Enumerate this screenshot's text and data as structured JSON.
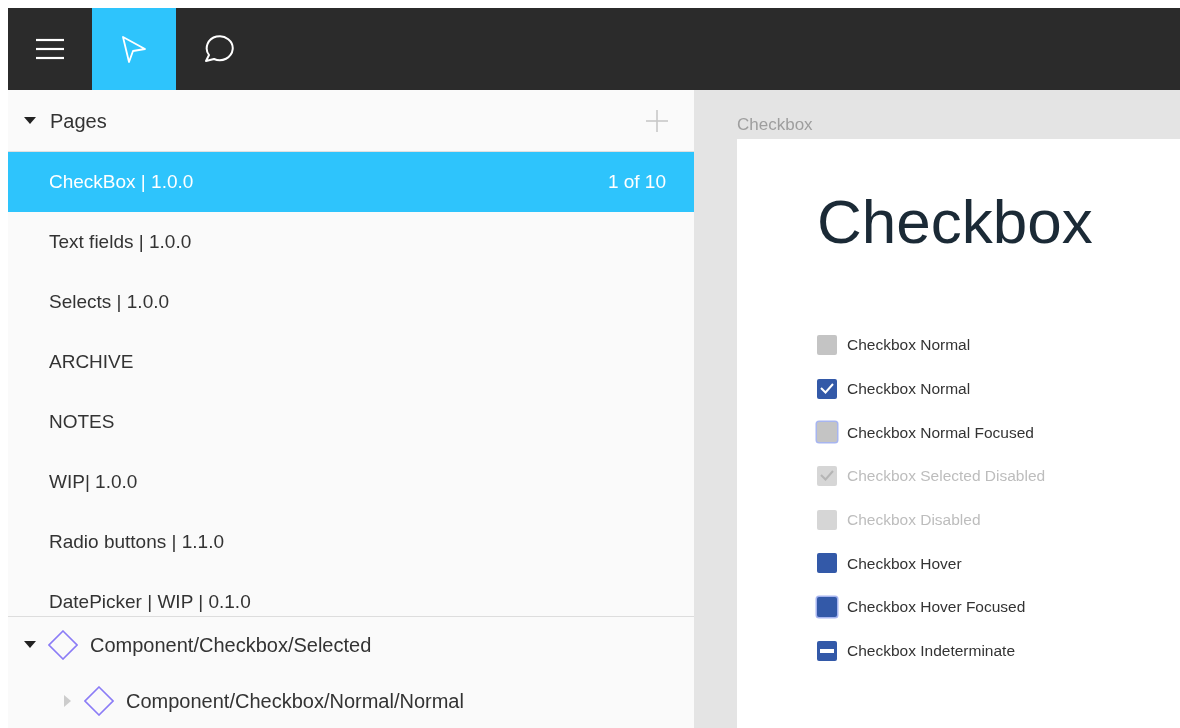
{
  "toolbar": [
    {
      "kind": "menu",
      "selected": false
    },
    {
      "kind": "pointer",
      "selected": true
    },
    {
      "kind": "comment",
      "selected": false
    }
  ],
  "pages": {
    "title": "Pages",
    "expanded": true,
    "items": [
      {
        "label": "CheckBox | 1.0.0",
        "count": "1 of 10",
        "selected": true
      },
      {
        "label": "Text fields | 1.0.0",
        "selected": false
      },
      {
        "label": "Selects | 1.0.0",
        "selected": false
      },
      {
        "label": "ARCHIVE",
        "selected": false
      },
      {
        "label": "NOTES",
        "selected": false
      },
      {
        "label": "WIP| 1.0.0",
        "selected": false
      },
      {
        "label": "Radio buttons | 1.1.0",
        "selected": false
      },
      {
        "label": "DatePicker | WIP | 0.1.0",
        "selected": false
      }
    ]
  },
  "layers": [
    {
      "label": "Component/Checkbox/Selected",
      "expanded": true,
      "children": [
        {
          "label": "Component/Checkbox/Normal/Normal",
          "expanded": false
        }
      ]
    }
  ],
  "canvas": {
    "artboard_label": "Checkbox",
    "heading": "Checkbox",
    "checkboxes": [
      {
        "label": "Checkbox Normal",
        "kind": "normal"
      },
      {
        "label": "Checkbox Normal",
        "kind": "checked"
      },
      {
        "label": "Checkbox Normal Focused",
        "kind": "focused"
      },
      {
        "label": "Checkbox Selected Disabled",
        "kind": "checkeddisabled"
      },
      {
        "label": "Checkbox Disabled",
        "kind": "disabled"
      },
      {
        "label": "Checkbox Hover",
        "kind": "hover"
      },
      {
        "label": "Checkbox Hover Focused",
        "kind": "hoverfocused"
      },
      {
        "label": "Checkbox Indeterminate",
        "kind": "indeterminate"
      }
    ]
  }
}
